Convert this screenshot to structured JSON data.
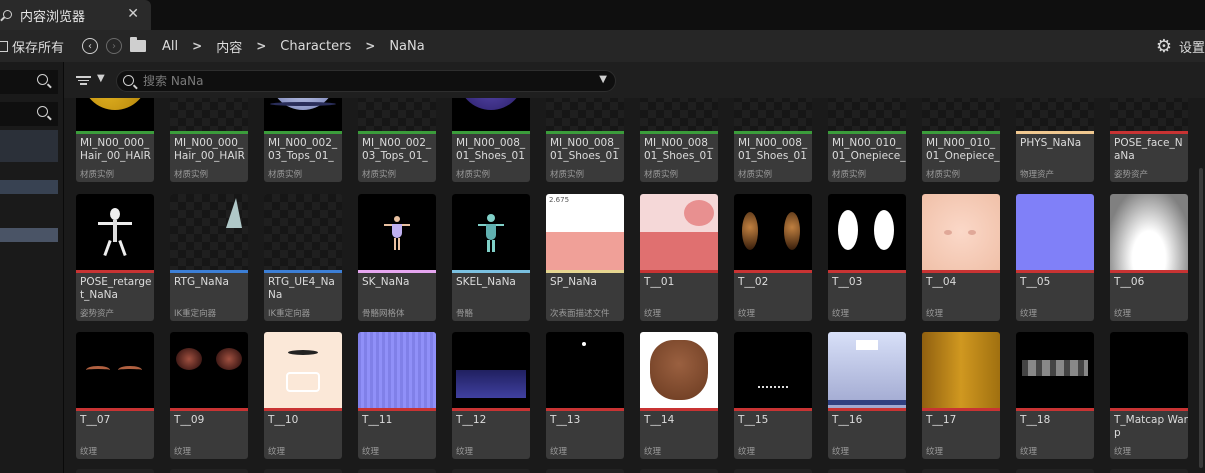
{
  "tab": {
    "title": "内容浏览器",
    "close": "✕",
    "icon": "content-browser-icon"
  },
  "toolbar": {
    "save_all": "保存所有",
    "back_icon": "arrow-left",
    "forward_icon": "arrow-right",
    "breadcrumbs": [
      "All",
      "内容",
      "Characters",
      "NaNa"
    ],
    "settings": "设置"
  },
  "search": {
    "placeholder": "搜索 NaNa"
  },
  "colors": {
    "material_instance": "#3b9d3b",
    "physics_asset": "#f0c890",
    "pose_asset": "#c83333",
    "ik_retargeter": "#3c7fd6",
    "skeletal_mesh": "#e6a6f0",
    "skeleton": "#7ac0e0",
    "subsurface_profile": "#e6d690",
    "texture": "#c83333"
  },
  "rows": [
    [
      {
        "name": "MI_N00_000_Hair_00_HAIR",
        "type": "材质实例",
        "color": "#3b9d3b",
        "thumb": "hair-sphere"
      },
      {
        "name": "MI_N00_000_Hair_00_HAIR",
        "type": "材质实例",
        "color": "#3b9d3b",
        "thumb": "checker"
      },
      {
        "name": "MI_N00_002_03_Tops_01_",
        "type": "材质实例",
        "color": "#3b9d3b",
        "thumb": "tops-sphere"
      },
      {
        "name": "MI_N00_002_03_Tops_01_",
        "type": "材质实例",
        "color": "#3b9d3b",
        "thumb": "checker-red"
      },
      {
        "name": "MI_N00_008_01_Shoes_01_",
        "type": "材质实例",
        "color": "#3b9d3b",
        "thumb": "shoes-sphere"
      },
      {
        "name": "MI_N00_008_01_Shoes_01_",
        "type": "材质实例",
        "color": "#3b9d3b",
        "thumb": "checker"
      },
      {
        "name": "MI_N00_008_01_Shoes_01_",
        "type": "材质实例",
        "color": "#3b9d3b",
        "thumb": "checker-smile"
      },
      {
        "name": "MI_N00_008_01_Shoes_01_",
        "type": "材质实例",
        "color": "#3b9d3b",
        "thumb": "checker"
      },
      {
        "name": "MI_N00_010_01_Onepiece_",
        "type": "材质实例",
        "color": "#3b9d3b",
        "thumb": "checker"
      },
      {
        "name": "MI_N00_010_01_Onepiece_",
        "type": "材质实例",
        "color": "#3b9d3b",
        "thumb": "checker"
      },
      {
        "name": "PHYS_NaNa",
        "type": "物理资产",
        "color": "#f0c890",
        "thumb": "phys"
      },
      {
        "name": "POSE_face_NaNa",
        "type": "姿势资产",
        "color": "#c83333",
        "thumb": "pose-face"
      }
    ],
    [
      {
        "name": "POSE_retarget_NaNa",
        "type": "姿势资产",
        "color": "#c83333",
        "thumb": "skeleton-figure"
      },
      {
        "name": "RTG_NaNa",
        "type": "IK重定向器",
        "color": "#3c7fd6",
        "thumb": "rtg"
      },
      {
        "name": "RTG_UE4_NaNa",
        "type": "IK重定向器",
        "color": "#3c7fd6",
        "thumb": "checker"
      },
      {
        "name": "SK_NaNa",
        "type": "骨骼网格体",
        "color": "#e6a6f0",
        "thumb": "sk-figure"
      },
      {
        "name": "SKEL_NaNa",
        "type": "骨骼",
        "color": "#7ac0e0",
        "thumb": "skel-figure"
      },
      {
        "name": "SP_NaNa",
        "type": "次表面描述文件",
        "color": "#e6d690",
        "thumb": "sp"
      },
      {
        "name": "T__01",
        "type": "纹理",
        "color": "#c83333",
        "thumb": "t01"
      },
      {
        "name": "T__02",
        "type": "纹理",
        "color": "#c83333",
        "thumb": "t02"
      },
      {
        "name": "T__03",
        "type": "纹理",
        "color": "#c83333",
        "thumb": "t03"
      },
      {
        "name": "T__04",
        "type": "纹理",
        "color": "#c83333",
        "thumb": "t04"
      },
      {
        "name": "T__05",
        "type": "纹理",
        "color": "#c83333",
        "thumb": "t05"
      },
      {
        "name": "T__06",
        "type": "纹理",
        "color": "#c83333",
        "thumb": "t06"
      }
    ],
    [
      {
        "name": "T__07",
        "type": "纹理",
        "color": "#c83333",
        "thumb": "t07"
      },
      {
        "name": "T__09",
        "type": "纹理",
        "color": "#c83333",
        "thumb": "t09"
      },
      {
        "name": "T__10",
        "type": "纹理",
        "color": "#c83333",
        "thumb": "t10"
      },
      {
        "name": "T__11",
        "type": "纹理",
        "color": "#c83333",
        "thumb": "t11"
      },
      {
        "name": "T__12",
        "type": "纹理",
        "color": "#c83333",
        "thumb": "t12"
      },
      {
        "name": "T__13",
        "type": "纹理",
        "color": "#c83333",
        "thumb": "t13"
      },
      {
        "name": "T__14",
        "type": "纹理",
        "color": "#c83333",
        "thumb": "t14"
      },
      {
        "name": "T__15",
        "type": "纹理",
        "color": "#c83333",
        "thumb": "t15"
      },
      {
        "name": "T__16",
        "type": "纹理",
        "color": "#c83333",
        "thumb": "t16"
      },
      {
        "name": "T__17",
        "type": "纹理",
        "color": "#c83333",
        "thumb": "t17"
      },
      {
        "name": "T__18",
        "type": "纹理",
        "color": "#c83333",
        "thumb": "t18"
      },
      {
        "name": "T_Matcap Warp",
        "type": "纹理",
        "color": "#c83333",
        "thumb": "black"
      }
    ]
  ],
  "sp_thumb_label": "2.675"
}
